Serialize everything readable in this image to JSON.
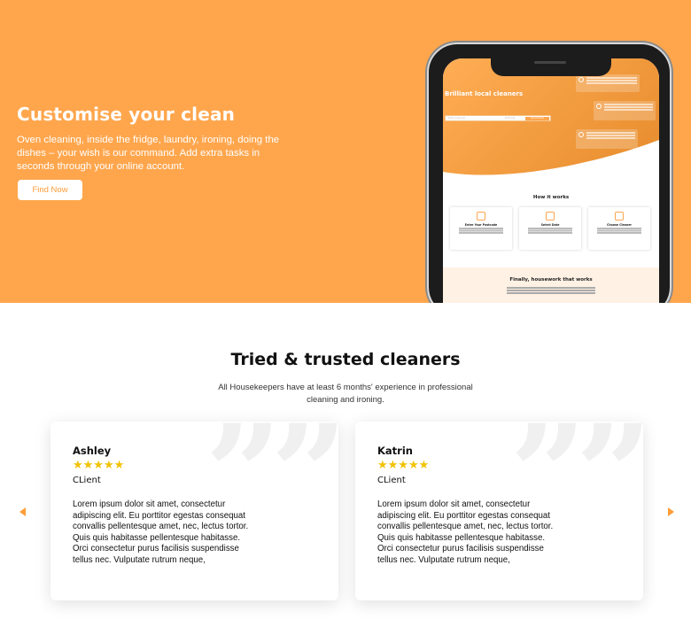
{
  "hero": {
    "title": "Customise your clean",
    "description": "Oven cleaning, inside the fridge, laundry, ironing, doing the dishes – your wish is our command. Add extra tasks in seconds through your online account.",
    "button_label": "Find Now",
    "background_color": "#ffa64d"
  },
  "phone_screen": {
    "title": "Brilliant local cleaners",
    "search_placeholder": "Enter postcode",
    "search_mid": "Postcode",
    "search_button": "Search Now",
    "how_title": "How it works",
    "steps": [
      {
        "title": "Enter Your Postcode"
      },
      {
        "title": "Select Date"
      },
      {
        "title": "Choose Cleaner"
      }
    ],
    "bottom_title": "Finally, housework that works"
  },
  "trusted": {
    "title": "Tried & trusted cleaners",
    "description": "All Housekeepers have at least 6 months' experience in professional cleaning and ironing.",
    "reviews": [
      {
        "name": "Ashley",
        "stars": "★★★★★",
        "role": "CLient",
        "text": "Lorem ipsum dolor sit amet, consectetur adipiscing elit. Eu porttitor egestas consequat convallis pellentesque amet, nec, lectus tortor. Quis quis habitasse pellentesque habitasse. Orci consectetur purus facilisis suspendisse tellus nec. Vulputate rutrum neque,"
      },
      {
        "name": "Katrin",
        "stars": "★★★★★",
        "role": "CLient",
        "text": "Lorem ipsum dolor sit amet, consectetur adipiscing elit. Eu porttitor egestas consequat convallis pellentesque amet, nec, lectus tortor. Quis quis habitasse pellentesque habitasse. Orci consectetur purus facilisis suspendisse tellus nec. Vulputate rutrum neque,"
      }
    ],
    "quote_mark": "”",
    "prev_icon": "triangle-left-icon",
    "next_icon": "triangle-right-icon",
    "accent_color": "#ff9d3a",
    "star_color": "#f2c200"
  }
}
